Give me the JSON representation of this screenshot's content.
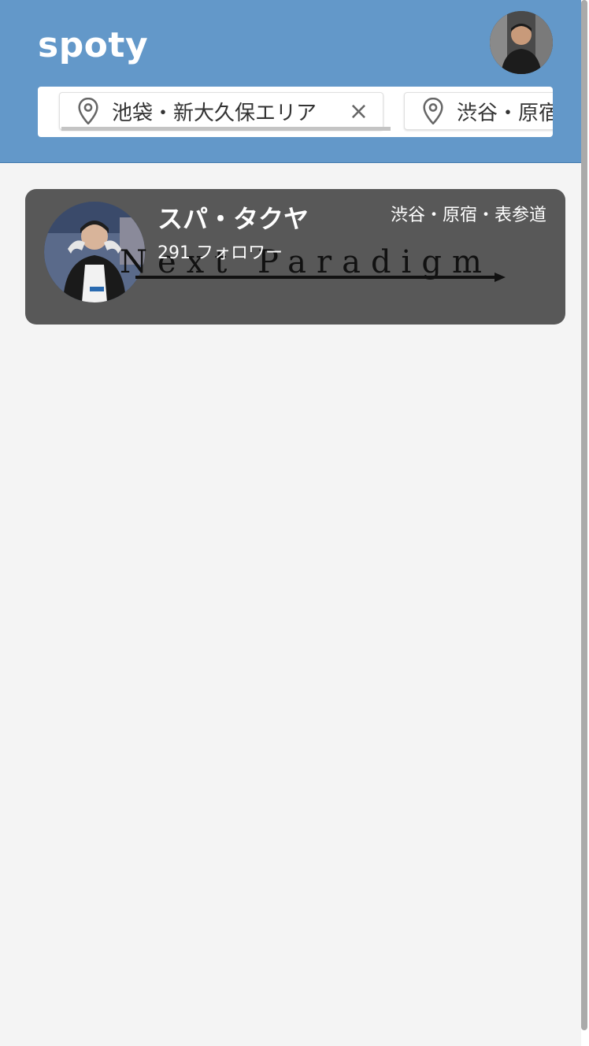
{
  "header": {
    "logo": "spoty",
    "background_color": "#6398c9"
  },
  "area_filters": [
    {
      "label": "池袋・新大久保エリア",
      "icon": "map-pin-icon",
      "close": "×"
    },
    {
      "label": "渋谷・原宿",
      "icon": "map-pin-icon"
    }
  ],
  "results": [
    {
      "name": "スパ・タクヤ",
      "area": "渋谷・原宿・表参道",
      "followers": "291 フォロワー",
      "watermark": "Next Paradigm"
    }
  ],
  "colors": {
    "card_background": "#585858",
    "page_background": "#f4f4f4"
  }
}
